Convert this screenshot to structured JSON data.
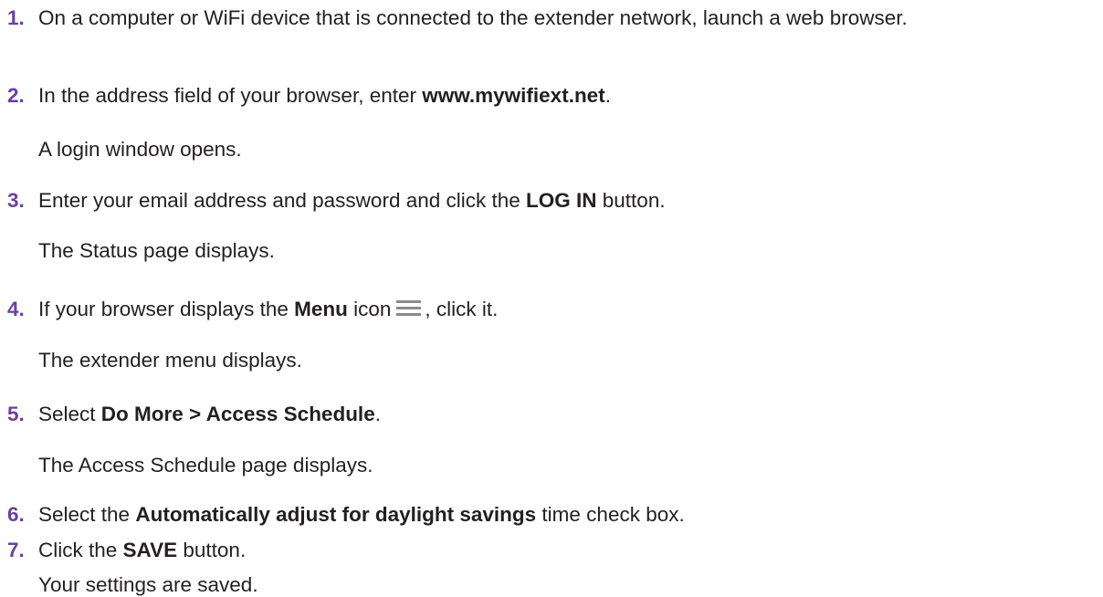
{
  "steps": [
    {
      "num": "1.",
      "text": "On a computer or WiFi device that is connected to the extender network, launch a web browser."
    },
    {
      "num": "2.",
      "pre": "In the address field of your browser, enter ",
      "bold": "www.mywifiext.net",
      "post": ".",
      "result": "A login window opens."
    },
    {
      "num": "3.",
      "pre": "Enter your email address and password and click the ",
      "bold": "LOG IN",
      "post": " button.",
      "result": "The Status page displays."
    },
    {
      "num": "4.",
      "pre": "If your browser displays the ",
      "bold": "Menu",
      "mid": " icon",
      "post": ", click it.",
      "icon": "menu-icon",
      "result": "The extender menu displays."
    },
    {
      "num": "5.",
      "pre": "Select ",
      "bold": "Do More > Access Schedule",
      "post": ".",
      "result": "The Access Schedule page displays."
    },
    {
      "num": "6.",
      "pre": "Select the ",
      "bold": "Automatically adjust for daylight savings",
      "post": " time check box."
    },
    {
      "num": "7.",
      "pre": "Click the ",
      "bold": "SAVE",
      "post": " button.",
      "result": "Your settings are saved."
    }
  ],
  "colors": {
    "step_number": "#6b3fa0",
    "text": "#231f20",
    "icon": "#8a8a8a"
  }
}
